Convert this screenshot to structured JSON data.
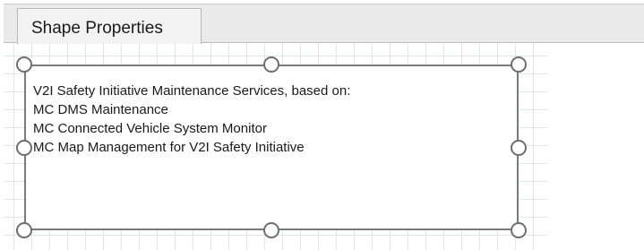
{
  "tabs": {
    "active_label": "Shape Properties"
  },
  "shape": {
    "lines": [
      "V2I Safety Initiative Maintenance Services, based on:",
      "MC DMS Maintenance",
      "MC Connected Vehicle System Monitor",
      "MC Map Management for V2I Safety Initiative"
    ]
  },
  "colors": {
    "tab_strip": "#eaeaea",
    "grid_line": "#dfe6ee",
    "shape_border": "#7a7a7a"
  }
}
